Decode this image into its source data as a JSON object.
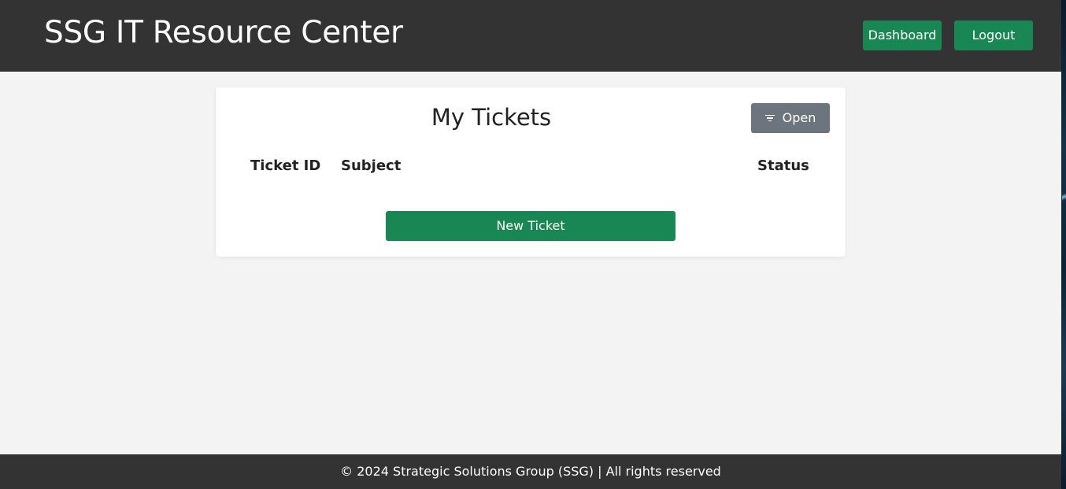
{
  "header": {
    "title": "SSG IT Resource Center",
    "nav": {
      "dashboard_label": "Dashboard",
      "logout_label": "Logout"
    }
  },
  "tickets": {
    "title": "My Tickets",
    "filter": {
      "label": "Open",
      "icon": "filter-icon"
    },
    "columns": [
      "Ticket ID",
      "Subject",
      "Status"
    ],
    "rows": [],
    "new_ticket_label": "New Ticket"
  },
  "footer": {
    "text": "© 2024 Strategic Solutions Group (SSG) | All rights reserved"
  },
  "colors": {
    "header_bg": "#333333",
    "primary_green": "#198754",
    "secondary_gray": "#6c757d",
    "page_bg": "#f3f3f3"
  }
}
